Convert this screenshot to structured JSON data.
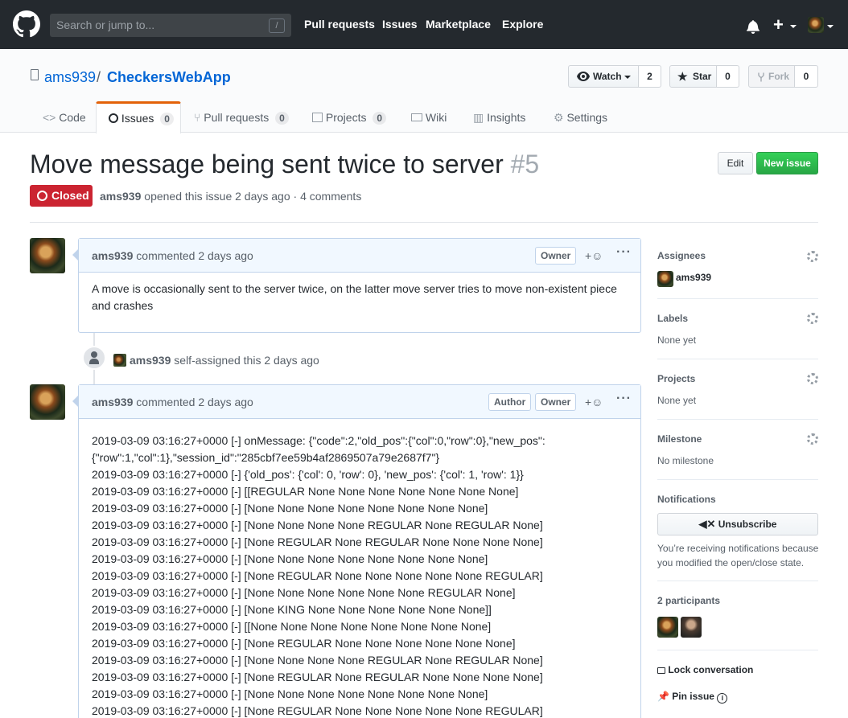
{
  "topbar": {
    "search_placeholder": "Search or jump to...",
    "search_shortcut": "/",
    "nav": [
      "Pull requests",
      "Issues",
      "Marketplace",
      "Explore"
    ],
    "plus_label": "+"
  },
  "repo": {
    "owner": "ams939",
    "separator": "/",
    "name": "CheckersWebApp",
    "watch_label": "Watch",
    "watch_count": "2",
    "star_label": "Star",
    "star_count": "0",
    "fork_label": "Fork",
    "fork_count": "0"
  },
  "tabs": [
    {
      "label": "Code",
      "count": ""
    },
    {
      "label": "Issues",
      "count": "0"
    },
    {
      "label": "Pull requests",
      "count": "0"
    },
    {
      "label": "Projects",
      "count": "0"
    },
    {
      "label": "Wiki",
      "count": ""
    },
    {
      "label": "Insights",
      "count": ""
    },
    {
      "label": "Settings",
      "count": ""
    }
  ],
  "issue": {
    "title": "Move message being sent twice to server",
    "number": "#5",
    "edit_label": "Edit",
    "new_issue_label": "New issue",
    "state": "Closed",
    "author": "ams939",
    "meta_text": "opened this issue 2 days ago · 4 comments"
  },
  "comments": [
    {
      "author": "ams939",
      "time": "commented 2 days ago",
      "labels": [
        "Owner"
      ],
      "body": "A move is occasionally sent to the server twice, on the latter move server tries to move non-existent piece and crashes"
    },
    {
      "author": "ams939",
      "time": "commented 2 days ago",
      "labels": [
        "Author",
        "Owner"
      ],
      "lines": [
        "2019-03-09 03:16:27+0000 [-] onMessage: {\"code\":2,\"old_pos\":{\"col\":0,\"row\":0},\"new_pos\":",
        "{\"row\":1,\"col\":1},\"session_id\":\"285cbf7ee59b4af2869507a79e2687f7\"}",
        "2019-03-09 03:16:27+0000 [-] {'old_pos': {'col': 0, 'row': 0}, 'new_pos': {'col': 1, 'row': 1}}",
        "2019-03-09 03:16:27+0000 [-] [[REGULAR None None None None None None None]",
        "2019-03-09 03:16:27+0000 [-] [None None None None None None None None]",
        "2019-03-09 03:16:27+0000 [-] [None None None None REGULAR None REGULAR None]",
        "2019-03-09 03:16:27+0000 [-] [None REGULAR None REGULAR None None None None]",
        "2019-03-09 03:16:27+0000 [-] [None None None None None None None None]",
        "2019-03-09 03:16:27+0000 [-] [None REGULAR None None None None None REGULAR]",
        "2019-03-09 03:16:27+0000 [-] [None None None None None None REGULAR None]",
        "2019-03-09 03:16:27+0000 [-] [None KING None None None None None None]]",
        "2019-03-09 03:16:27+0000 [-] [[None None None None None None None None]",
        "2019-03-09 03:16:27+0000 [-] [None REGULAR None None None None None None]",
        "2019-03-09 03:16:27+0000 [-] [None None None None REGULAR None REGULAR None]",
        "2019-03-09 03:16:27+0000 [-] [None REGULAR None REGULAR None None None None]",
        "2019-03-09 03:16:27+0000 [-] [None None None None None None None None]",
        "2019-03-09 03:16:27+0000 [-] [None REGULAR None None None None None REGULAR]"
      ]
    }
  ],
  "event": {
    "author": "ams939",
    "text": "self-assigned this 2 days ago"
  },
  "sidebar": {
    "assignees_title": "Assignees",
    "assignee": "ams939",
    "labels_title": "Labels",
    "labels_value": "None yet",
    "projects_title": "Projects",
    "projects_value": "None yet",
    "milestone_title": "Milestone",
    "milestone_value": "No milestone",
    "notifications_title": "Notifications",
    "unsubscribe_label": "Unsubscribe",
    "notification_note": "You’re receiving notifications because you modified the open/close state.",
    "participants_title": "2 participants",
    "lock_label": "Lock conversation",
    "pin_label": "Pin issue"
  }
}
